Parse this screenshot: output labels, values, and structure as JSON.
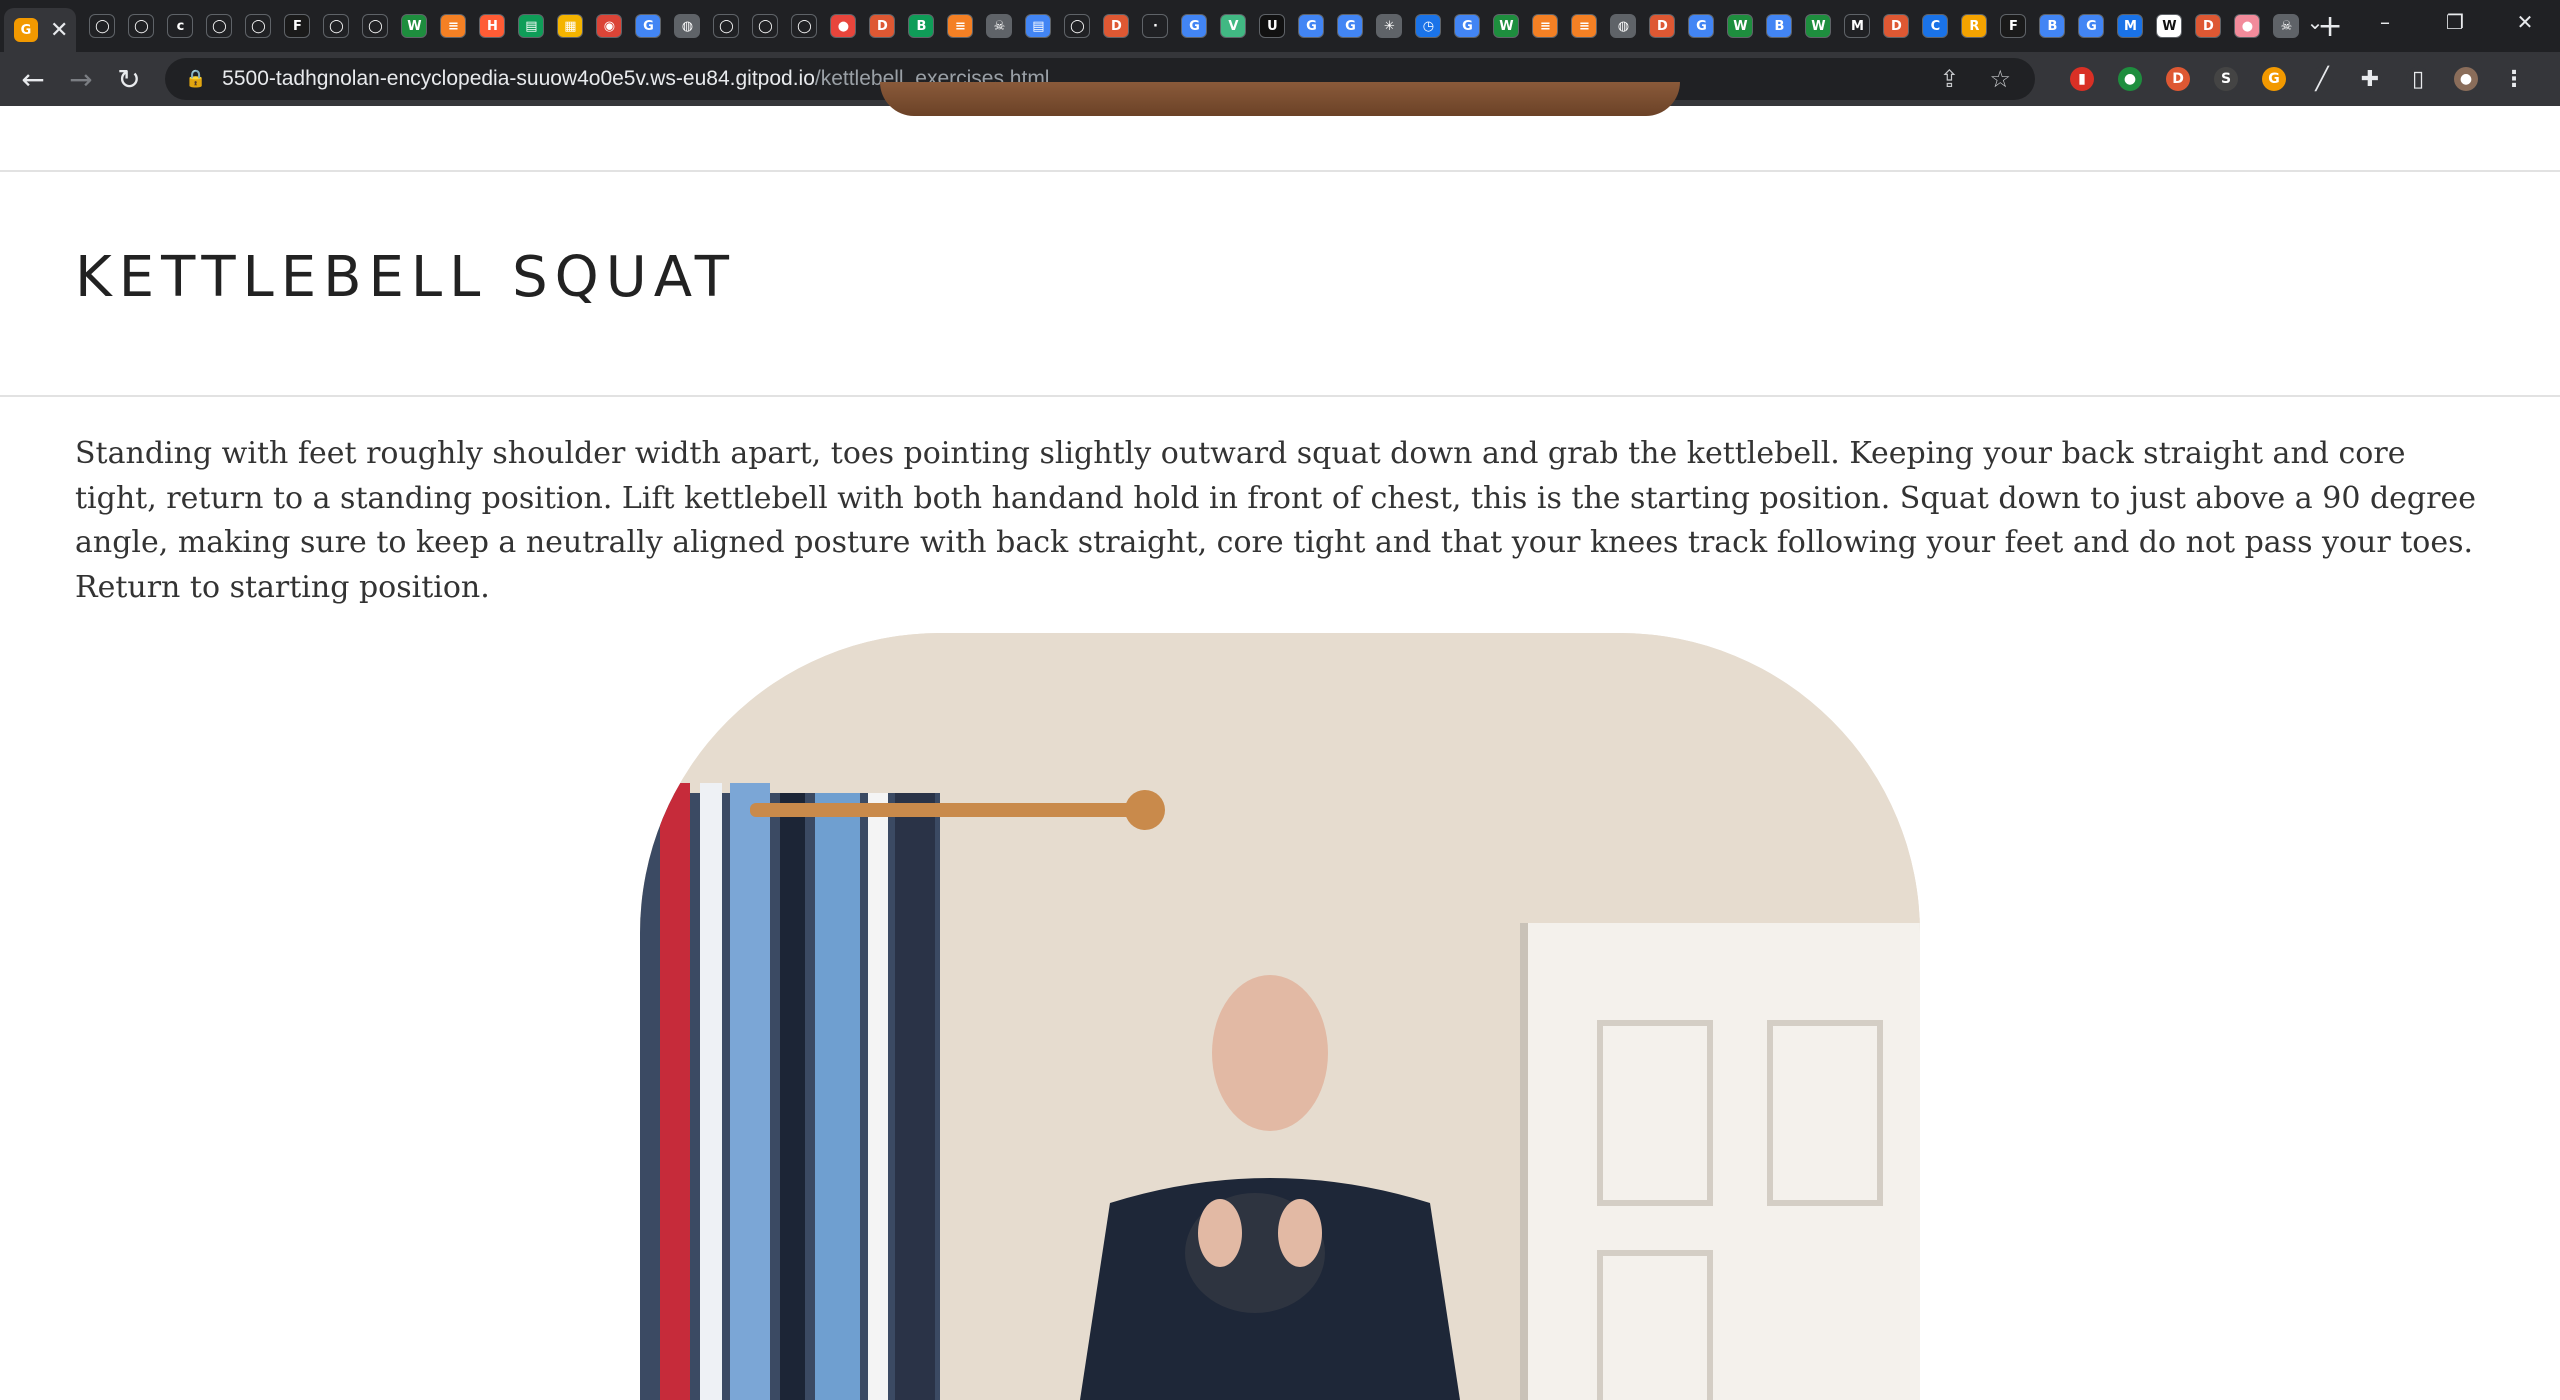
{
  "browser": {
    "address_host": "5500-tadhgnolan-encyclopedia-suuow4o0e5v.ws-eu84.gitpod.io",
    "address_path": "/kettlebell_exercises.html",
    "pinned_tabs": [
      {
        "icon": "github-icon",
        "glyph": "◯",
        "color": "#202124"
      },
      {
        "icon": "github-icon",
        "glyph": "◯",
        "color": "#202124"
      },
      {
        "icon": "circle-c-icon",
        "glyph": "c",
        "color": "#202124"
      },
      {
        "icon": "github-icon",
        "glyph": "◯",
        "color": "#202124"
      },
      {
        "icon": "github-icon",
        "glyph": "◯",
        "color": "#202124"
      },
      {
        "icon": "f-icon",
        "glyph": "F",
        "color": "#1a1a1a"
      },
      {
        "icon": "github-icon",
        "glyph": "◯",
        "color": "#202124"
      },
      {
        "icon": "github-icon",
        "glyph": "◯",
        "color": "#202124"
      },
      {
        "icon": "w-icon",
        "glyph": "W",
        "color": "#1e8e3e"
      },
      {
        "icon": "stack-icon",
        "glyph": "≡",
        "color": "#f48024"
      },
      {
        "icon": "hubspot-icon",
        "glyph": "H",
        "color": "#ff5c35"
      },
      {
        "icon": "sheet-icon",
        "glyph": "▤",
        "color": "#0f9d58"
      },
      {
        "icon": "calc-icon",
        "glyph": "▦",
        "color": "#f4b400"
      },
      {
        "icon": "chrome-icon",
        "glyph": "◉",
        "color": "#db4437"
      },
      {
        "icon": "google-icon",
        "glyph": "G",
        "color": "#4285f4"
      },
      {
        "icon": "globe-icon",
        "glyph": "◍",
        "color": "#5f6368"
      },
      {
        "icon": "github-icon",
        "glyph": "◯",
        "color": "#202124"
      },
      {
        "icon": "github-icon",
        "glyph": "◯",
        "color": "#202124"
      },
      {
        "icon": "github-icon",
        "glyph": "◯",
        "color": "#202124"
      },
      {
        "icon": "circle-icon",
        "glyph": "●",
        "color": "#e8453c"
      },
      {
        "icon": "duckduckgo-icon",
        "glyph": "D",
        "color": "#de5833"
      },
      {
        "icon": "b-icon",
        "glyph": "B",
        "color": "#0f9d58"
      },
      {
        "icon": "stack-icon",
        "glyph": "≡",
        "color": "#f48024"
      },
      {
        "icon": "skull-icon",
        "glyph": "☠",
        "color": "#5f6368"
      },
      {
        "icon": "sheet-icon",
        "glyph": "▤",
        "color": "#4285f4"
      },
      {
        "icon": "github-icon",
        "glyph": "◯",
        "color": "#202124"
      },
      {
        "icon": "duckduckgo-icon",
        "glyph": "D",
        "color": "#de5833"
      },
      {
        "icon": "blank-icon",
        "glyph": "·",
        "color": "#202124"
      },
      {
        "icon": "google-icon",
        "glyph": "G",
        "color": "#4285f4"
      },
      {
        "icon": "vue-icon",
        "glyph": "V",
        "color": "#41b883"
      },
      {
        "icon": "u-icon",
        "glyph": "U",
        "color": "#111111"
      },
      {
        "icon": "google-icon",
        "glyph": "G",
        "color": "#4285f4"
      },
      {
        "icon": "google-icon",
        "glyph": "G",
        "color": "#4285f4"
      },
      {
        "icon": "sparkle-icon",
        "glyph": "✳",
        "color": "#5f6368"
      },
      {
        "icon": "clock-icon",
        "glyph": "◷",
        "color": "#1a73e8"
      },
      {
        "icon": "google-icon",
        "glyph": "G",
        "color": "#4285f4"
      },
      {
        "icon": "w-icon",
        "glyph": "W",
        "color": "#1e8e3e"
      },
      {
        "icon": "stack-icon",
        "glyph": "≡",
        "color": "#f48024"
      },
      {
        "icon": "stack-icon",
        "glyph": "≡",
        "color": "#f48024"
      },
      {
        "icon": "globe-icon",
        "glyph": "◍",
        "color": "#5f6368"
      },
      {
        "icon": "duckduckgo-icon",
        "glyph": "D",
        "color": "#de5833"
      },
      {
        "icon": "google-icon",
        "glyph": "G",
        "color": "#4285f4"
      },
      {
        "icon": "w-icon",
        "glyph": "W",
        "color": "#1e8e3e"
      },
      {
        "icon": "b-icon",
        "glyph": "B",
        "color": "#4285f4"
      },
      {
        "icon": "w-icon",
        "glyph": "W",
        "color": "#1e8e3e"
      },
      {
        "icon": "m-icon",
        "glyph": "M",
        "color": "#202124"
      },
      {
        "icon": "duckduckgo-icon",
        "glyph": "D",
        "color": "#de5833"
      },
      {
        "icon": "circle-c-icon",
        "glyph": "C",
        "color": "#1a73e8"
      },
      {
        "icon": "r-icon",
        "glyph": "R",
        "color": "#f4a300"
      },
      {
        "icon": "f-icon",
        "glyph": "F",
        "color": "#1a1a1a"
      },
      {
        "icon": "b-icon",
        "glyph": "B",
        "color": "#4285f4"
      },
      {
        "icon": "google-icon",
        "glyph": "G",
        "color": "#4285f4"
      },
      {
        "icon": "m-icon",
        "glyph": "M",
        "color": "#1a73e8"
      },
      {
        "icon": "wikipedia-icon",
        "glyph": "W",
        "color": "#ffffff"
      },
      {
        "icon": "duckduckgo-icon",
        "glyph": "D",
        "color": "#de5833"
      },
      {
        "icon": "brain-icon",
        "glyph": "●",
        "color": "#f28b9b"
      },
      {
        "icon": "skull-icon",
        "glyph": "☠",
        "color": "#5f6368"
      }
    ],
    "extensions": [
      {
        "icon": "bookmark-red-icon",
        "glyph": "▮",
        "color": "#d93025"
      },
      {
        "icon": "green-ext-icon",
        "glyph": "●",
        "color": "#1e8e3e"
      },
      {
        "icon": "duckduckgo-icon",
        "glyph": "D",
        "color": "#de5833"
      },
      {
        "icon": "s-ext-icon",
        "glyph": "S",
        "color": "#444444"
      },
      {
        "icon": "g-ext-icon",
        "glyph": "G",
        "color": "#f29900"
      },
      {
        "icon": "dropper-icon",
        "glyph": "╱",
        "color": "#35363a"
      },
      {
        "icon": "puzzle-icon",
        "glyph": "✚",
        "color": "#35363a"
      },
      {
        "icon": "sidepanel-icon",
        "glyph": "▯",
        "color": "#35363a"
      },
      {
        "icon": "profile-avatar-icon",
        "glyph": "●",
        "color": "#8a6d5a"
      },
      {
        "icon": "kebab-menu-icon",
        "glyph": "⋮",
        "color": "#35363a"
      }
    ]
  },
  "page": {
    "title": "KETTLEBELL SQUAT",
    "description": "Standing with feet roughly shoulder width apart, toes pointing slightly outward squat down and grab the kettlebell. Keeping your back straight and core tight, return to a standing position. Lift kettlebell with both handand hold in front of chest, this is the starting position. Squat down to just above a 90 degree angle, making sure to keep a neutrally aligned posture with back straight, core tight and that your knees track following your feet and do not pass your toes. Return to starting position."
  }
}
